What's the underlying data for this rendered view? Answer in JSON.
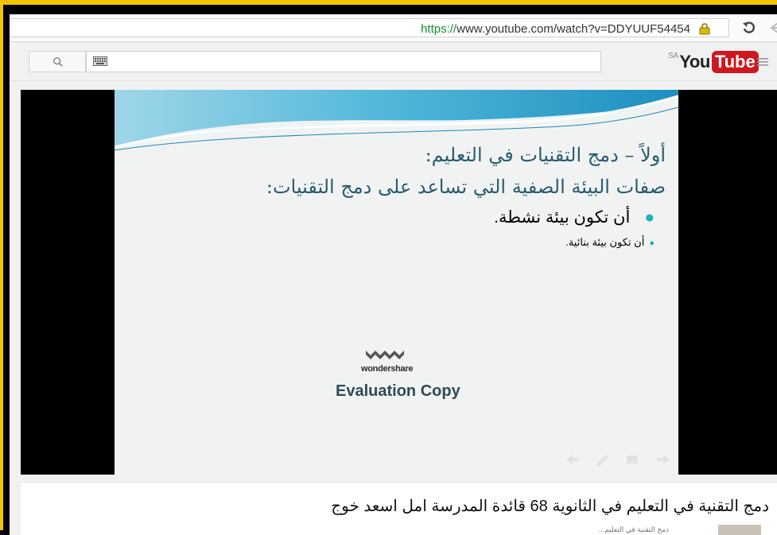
{
  "browser": {
    "url_scheme": "https://",
    "url_rest": "www.youtube.com/watch?v=DDYUUF54454"
  },
  "youtube": {
    "logo_region": "SA",
    "logo_you": "You",
    "logo_tube": "Tube"
  },
  "slide": {
    "title_line1": "أولاً – دمج التقنيات في التعليم:",
    "title_line2": "صفات البيئة الصفية التي تساعد على دمج التقنيات:",
    "bullet1": "أن تكون بيئة نشطة.",
    "bullet2": "أن تكون بيئة بنائية.",
    "watermark_brand": "wondershare",
    "watermark_text": "Evaluation Copy"
  },
  "video": {
    "title": "دمج التقنية في التعليم في الثانوية 68 قائدة المدرسة امل اسعد خوج",
    "below_snippet": "دمج التقنية في التعليم..."
  },
  "colors": {
    "frame": "#f4c400",
    "accent_teal": "#1fb3b7",
    "youtube_red": "#cc181e",
    "url_green": "#1a8f2e"
  }
}
